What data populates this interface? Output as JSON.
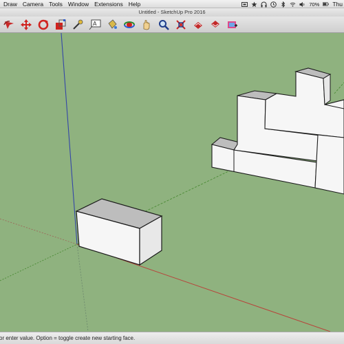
{
  "menubar": {
    "items": [
      "Draw",
      "Camera",
      "Tools",
      "Window",
      "Extensions",
      "Help"
    ],
    "battery": "70%",
    "day": "Thu"
  },
  "window": {
    "title": "Untitled - SketchUp Pro 2016"
  },
  "toolbar": {
    "tools": [
      "select-icon",
      "move-icon",
      "rotate-icon",
      "scale-icon",
      "tape-measure-icon",
      "text-icon",
      "paint-bucket-icon",
      "orbit-icon",
      "pan-icon",
      "zoom-icon",
      "zoom-extents-icon",
      "previous-view-icon",
      "next-view-icon",
      "add-location-icon"
    ]
  },
  "status": {
    "text": "or enter value.  Option = toggle create new starting face."
  },
  "colors": {
    "ground": "#8fb27f",
    "face": "#f6f6f6",
    "face_side": "#e8e8e8",
    "edge": "#1a1a1a",
    "red_axis": "#b8433a",
    "green_axis": "#4a8a34",
    "blue_axis": "#3345a8"
  }
}
